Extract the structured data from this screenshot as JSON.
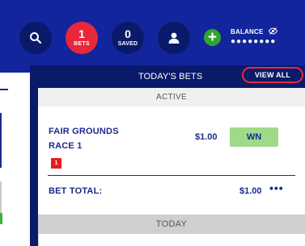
{
  "header": {
    "search_icon": "search-icon",
    "bets": {
      "count": "1",
      "label": "BETS"
    },
    "saved": {
      "count": "0",
      "label": "SAVED"
    },
    "user_icon": "user-icon",
    "add_icon": "plus",
    "balance_label": "BALANCE",
    "balance_masked": "●●●●●●●●"
  },
  "panel": {
    "title": "TODAY'S BETS",
    "view_all_label": "VIEW ALL",
    "active_label": "ACTIVE",
    "bet": {
      "race_line1": "FAIR GROUNDS",
      "race_line2": "RACE 1",
      "amount": "$1.00",
      "selection": "WN",
      "runner_badge": "1"
    },
    "bet_total_label": "BET TOTAL:",
    "bet_total_value": "$1.00",
    "more_label": "•••",
    "today_label": "TODAY"
  },
  "colors": {
    "header_bg": "#12259c",
    "panel_bg": "#0a1a6a",
    "accent_red": "#e8283a",
    "text_navy": "#1b2a8a",
    "wn_green": "#9fd98a",
    "add_green": "#2fa52f"
  }
}
